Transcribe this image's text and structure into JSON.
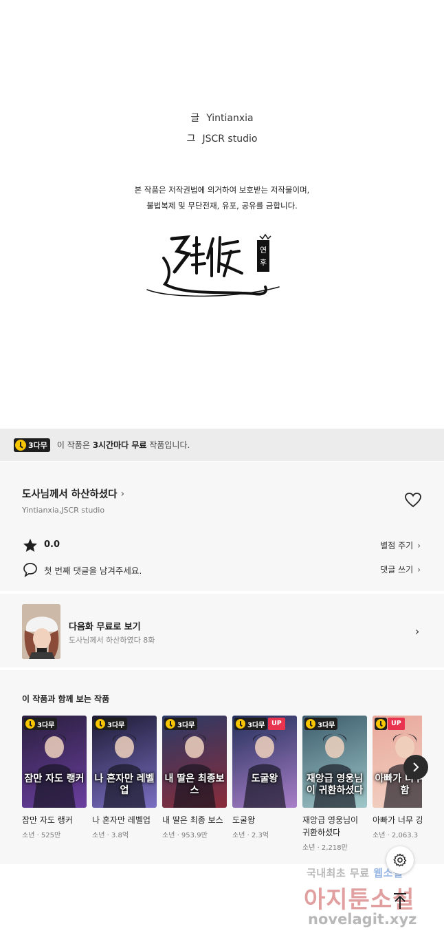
{
  "credits": {
    "writer_key": "글",
    "writer": "Yintianxia",
    "artist_key": "그",
    "artist": "JSCR studio",
    "copyright_line1": "본 작품은 저작권법에 의거하여 보호받는 저작물이며,",
    "copyright_line2": "불법복제 및 무단전재, 유포, 공유를 금합니다.",
    "publisher_logo_text": "延候 연후"
  },
  "free_banner": {
    "badge": "3다무",
    "text_before": "이 작품은 ",
    "text_bold": "3시간마다 무료",
    "text_after": " 작품입니다."
  },
  "info": {
    "title": "도사님께서 하산하셨다",
    "authors": "Yintianxia,JSCR studio",
    "score": "0.0",
    "rate_label": "별점 주기",
    "comment_prompt": "첫 번째 댓글을 남겨주세요.",
    "comment_label": "댓글 쓰기"
  },
  "next_episode": {
    "title": "다음화 무료로 보기",
    "subtitle": "도사님께서 하산하였다 8화"
  },
  "related": {
    "heading": "이 작품과 함께 보는 작품",
    "items": [
      {
        "title": "잠만 자도 랭커",
        "meta": "소년 · 525만",
        "badge": "3다무",
        "up": "",
        "cover_text": "잠만 자도 랭커",
        "colors": [
          "#2a1f3d",
          "#6b3fa0"
        ]
      },
      {
        "title": "나 혼자만 레벨업",
        "meta": "소년 · 3.8억",
        "badge": "3다무",
        "up": "",
        "cover_text": "나 혼자만 레벨업",
        "colors": [
          "#1c1a33",
          "#7a6fc2"
        ]
      },
      {
        "title": "내 딸은 최종 보스",
        "meta": "소년 · 953.9만",
        "badge": "3다무",
        "up": "",
        "cover_text": "내 딸은 최종보스",
        "colors": [
          "#2b3a66",
          "#8a2c3a"
        ]
      },
      {
        "title": "도굴왕",
        "meta": "소년 · 2.3억",
        "badge": "3다무",
        "up": "UP",
        "cover_text": "도굴왕",
        "colors": [
          "#23305a",
          "#a97fc9"
        ]
      },
      {
        "title": "재앙급 영웅님이 귀환하셨다",
        "meta": "소년 · 2,218만",
        "badge": "3다무",
        "up": "",
        "cover_text": "재앙급 영웅님이 귀환하셨다",
        "colors": [
          "#3c5b6b",
          "#9fc7c9"
        ]
      },
      {
        "title": "아빠가 너무 강",
        "meta": "소년 · 2,063.3",
        "badge": "",
        "up": "UP",
        "cover_text": "아빠가 너무 강함",
        "colors": [
          "#e8a79a",
          "#f3d6c8"
        ]
      }
    ]
  },
  "watermark": {
    "line1_a": "국내최초 무료 ",
    "line1_b": "웹소설",
    "line2": "아지툰소설",
    "line3": "novelagit.xyz"
  },
  "icons": {
    "heart": "heart-icon",
    "star": "star-icon",
    "comment": "comment-icon",
    "chevron": "chevron-right-icon",
    "settings": "gear-icon",
    "scroll_top": "arrow-up-icon"
  }
}
